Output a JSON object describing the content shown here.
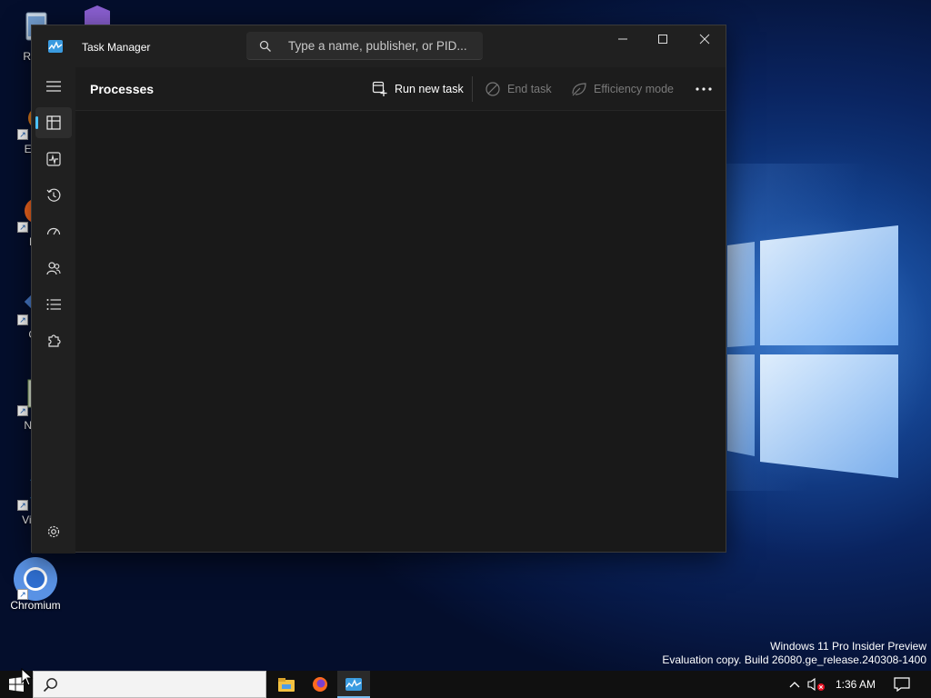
{
  "desktop": {
    "icons": [
      {
        "label": "Recy",
        "icon": "recycle-bin-icon"
      },
      {
        "label": "Ever",
        "icon": "everything-icon"
      },
      {
        "label": "Fir",
        "icon": "firefox-icon"
      },
      {
        "label": "Git",
        "icon": "git-icon"
      },
      {
        "label": "Note",
        "icon": "notepad-plus-plus-icon"
      },
      {
        "label": "Visua",
        "label2": "C",
        "icon": "vscode-icon"
      },
      {
        "label": "Chromium",
        "icon": "chromium-icon"
      }
    ],
    "watermark": {
      "line1": "Windows 11 Pro Insider Preview",
      "line2": "Evaluation copy. Build 26080.ge_release.240308-1400"
    }
  },
  "task_manager": {
    "title": "Task Manager",
    "search": {
      "placeholder": "Type a name, publisher, or PID..."
    },
    "window_controls": [
      "minimize",
      "maximize",
      "close"
    ],
    "page_title": "Processes",
    "toolbar": {
      "run_new_task": "Run new task",
      "end_task": "End task",
      "efficiency_mode": "Efficiency mode",
      "more": "More options"
    },
    "nav": [
      {
        "id": "menu",
        "icon": "hamburger-icon"
      },
      {
        "id": "processes",
        "icon": "processes-icon",
        "active": true
      },
      {
        "id": "performance",
        "icon": "performance-icon"
      },
      {
        "id": "app-history",
        "icon": "history-icon"
      },
      {
        "id": "startup-apps",
        "icon": "speedometer-icon"
      },
      {
        "id": "users",
        "icon": "users-icon"
      },
      {
        "id": "details",
        "icon": "list-icon"
      },
      {
        "id": "services",
        "icon": "puzzle-icon"
      },
      {
        "id": "settings",
        "icon": "gear-icon"
      }
    ]
  },
  "taskbar": {
    "apps": [
      "file-explorer-icon",
      "firefox-icon",
      "task-manager-icon"
    ],
    "time": "1:36 AM"
  },
  "colors": {
    "accent": "#4cc2ff",
    "window_bg": "#1c1c1c"
  }
}
